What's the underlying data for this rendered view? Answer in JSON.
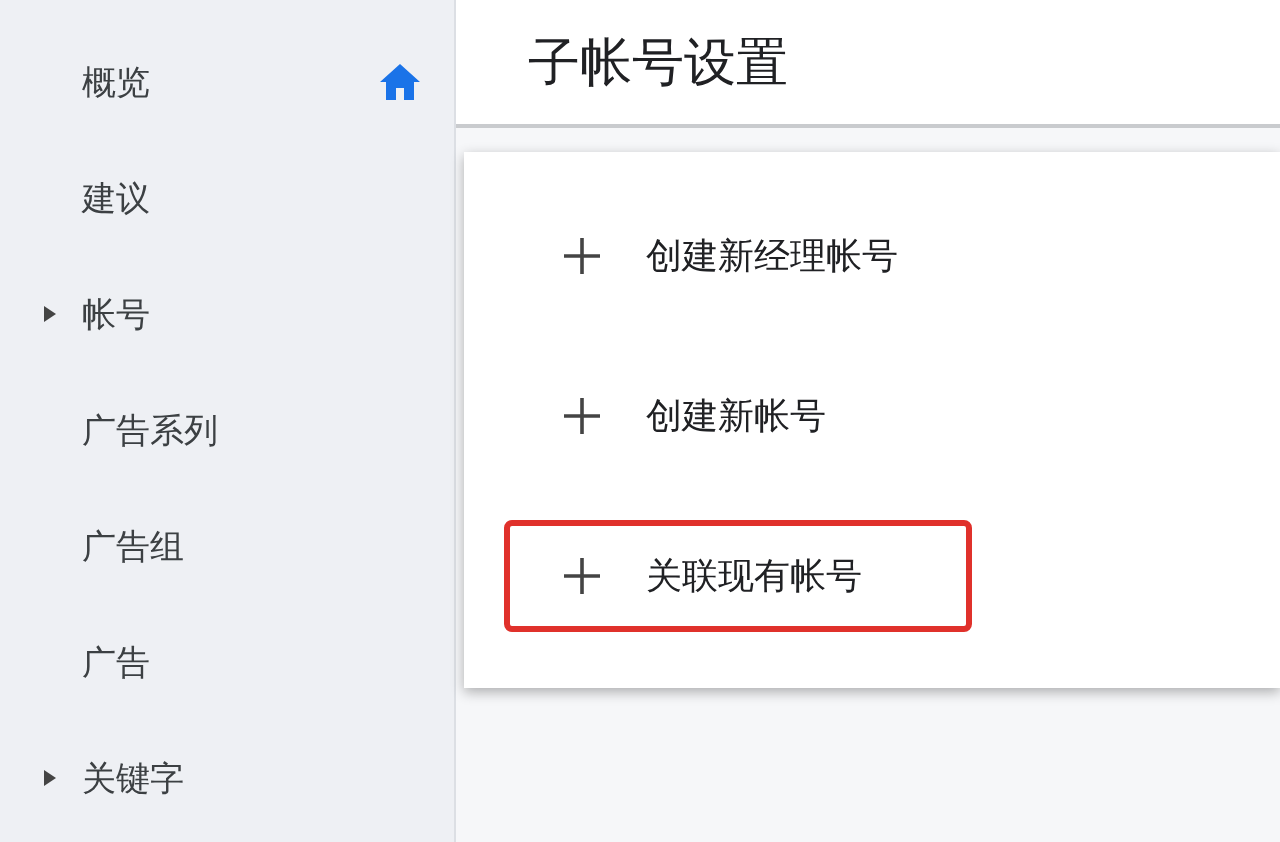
{
  "sidebar": {
    "items": [
      {
        "label": "概览",
        "kind": "home"
      },
      {
        "label": "建议",
        "kind": "link"
      },
      {
        "label": "帐号",
        "kind": "group"
      },
      {
        "label": "广告系列",
        "kind": "link"
      },
      {
        "label": "广告组",
        "kind": "link"
      },
      {
        "label": "广告",
        "kind": "link"
      },
      {
        "label": "关键字",
        "kind": "group"
      }
    ]
  },
  "header": {
    "title": "子帐号设置"
  },
  "menu": {
    "items": [
      {
        "label": "创建新经理帐号",
        "highlighted": false
      },
      {
        "label": "创建新帐号",
        "highlighted": false
      },
      {
        "label": "关联现有帐号",
        "highlighted": true
      }
    ]
  }
}
